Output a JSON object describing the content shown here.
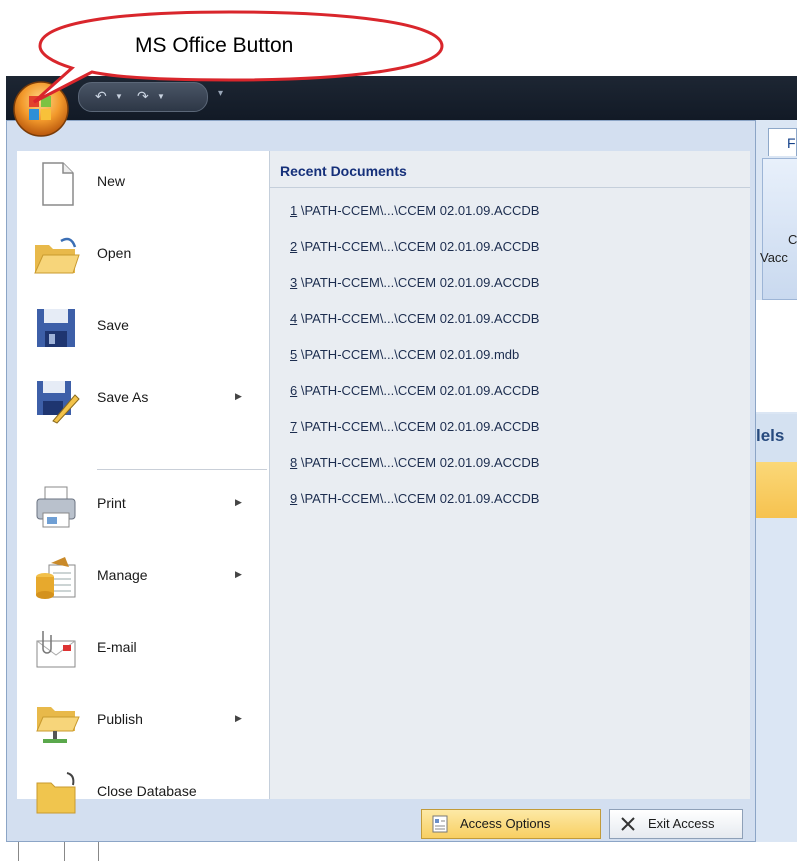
{
  "callout": {
    "text": "MS Office Button"
  },
  "background": {
    "tab_letter": "F",
    "ribbon_text_1": "C",
    "ribbon_text_2": "Vacc",
    "section_text": "lels"
  },
  "qat": {
    "icons": [
      "undo-icon",
      "redo-icon"
    ]
  },
  "menu": {
    "items": [
      {
        "label": "New",
        "icon": "new-document-icon",
        "submenu": false
      },
      {
        "label": "Open",
        "icon": "open-folder-icon",
        "submenu": false
      },
      {
        "label": "Save",
        "icon": "floppy-disk-icon",
        "submenu": false
      },
      {
        "label": "Save As",
        "icon": "save-as-icon",
        "submenu": true
      },
      {
        "label": "Print",
        "icon": "printer-icon",
        "submenu": true
      },
      {
        "label": "Manage",
        "icon": "manage-database-icon",
        "submenu": true
      },
      {
        "label": "E-mail",
        "icon": "email-icon",
        "submenu": false
      },
      {
        "label": "Publish",
        "icon": "publish-icon",
        "submenu": true
      },
      {
        "label": "Close Database",
        "icon": "close-database-icon",
        "submenu": false
      }
    ],
    "recent_header": "Recent Documents",
    "recent": [
      {
        "num": "1",
        "path": " \\PATH-CCEM\\...\\CCEM 02.01.09.ACCDB"
      },
      {
        "num": "2",
        "path": " \\PATH-CCEM\\...\\CCEM 02.01.09.ACCDB"
      },
      {
        "num": "3",
        "path": " \\PATH-CCEM\\...\\CCEM 02.01.09.ACCDB"
      },
      {
        "num": "4",
        "path": " \\PATH-CCEM\\...\\CCEM 02.01.09.ACCDB"
      },
      {
        "num": "5",
        "path": " \\PATH-CCEM\\...\\CCEM 02.01.09.mdb"
      },
      {
        "num": "6",
        "path": " \\PATH-CCEM\\...\\CCEM 02.01.09.ACCDB"
      },
      {
        "num": "7",
        "path": " \\PATH-CCEM\\...\\CCEM 02.01.09.ACCDB"
      },
      {
        "num": "8",
        "path": " \\PATH-CCEM\\...\\CCEM 02.01.09.ACCDB"
      },
      {
        "num": "9",
        "path": " \\PATH-CCEM\\...\\CCEM 02.01.09.ACCDB"
      }
    ],
    "options_label": "Access Options",
    "exit_label": "Exit Access"
  }
}
